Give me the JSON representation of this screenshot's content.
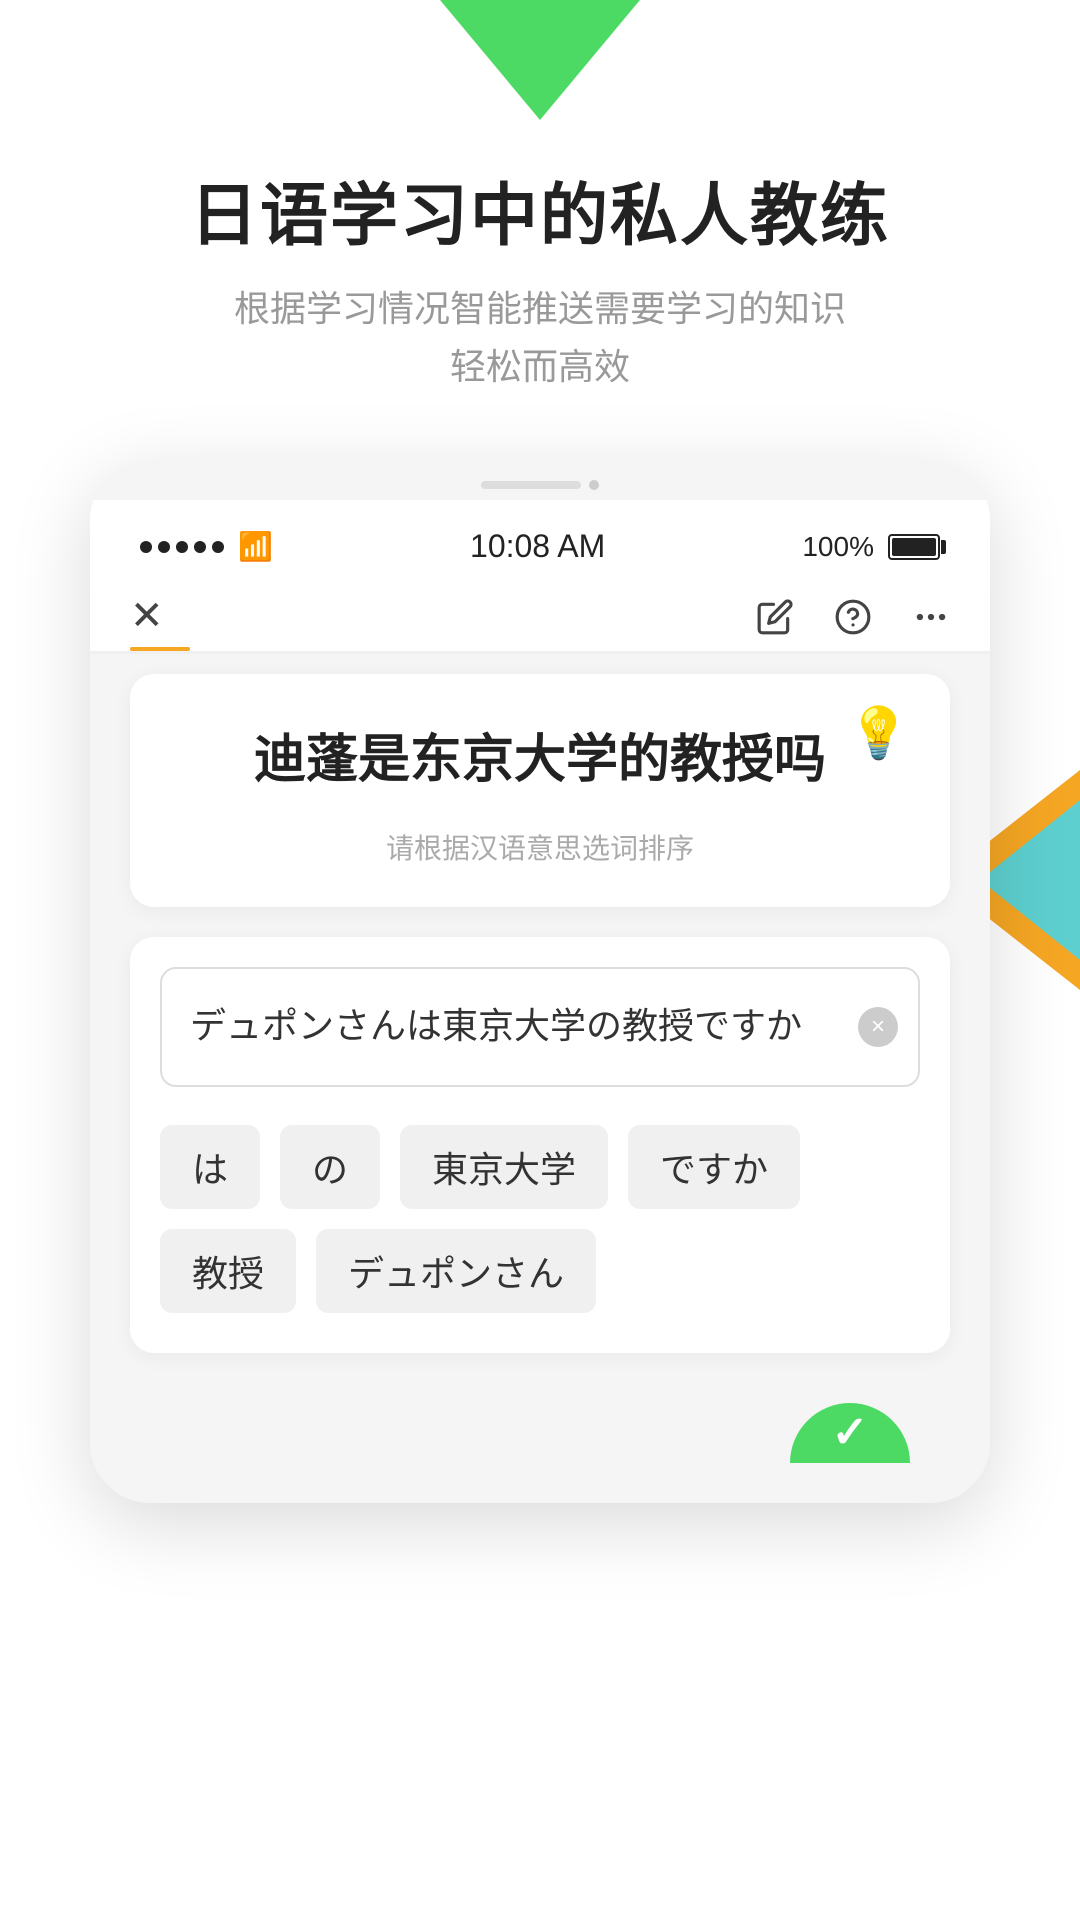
{
  "app": {
    "logo_triangle_color": "#4cd964"
  },
  "header": {
    "main_title": "日语学习中的私人教练",
    "subtitle_line1": "根据学习情况智能推送需要学习的知识",
    "subtitle_line2": "轻松而高效"
  },
  "phone": {
    "status_bar": {
      "time": "10:08 AM",
      "battery": "100%"
    },
    "nav": {
      "close_label": "✕",
      "edit_icon": "📝",
      "help_icon": "?",
      "more_icon": "..."
    },
    "question_card": {
      "main_text": "迪蓬是东京大学的教授吗",
      "hint_text": "请根据汉语意思选词排序",
      "lightbulb": "💡"
    },
    "answer_card": {
      "input_text": "デュポンさんは東京大学の教授ですか",
      "clear_btn": "×",
      "words": [
        "は",
        "の",
        "東京大学",
        "ですか",
        "教授",
        "デュポンさん"
      ]
    },
    "bottom_check": "✓"
  },
  "decorations": {
    "teal_color": "#5ecfcf",
    "orange_color": "#f5a623",
    "green_color": "#4cd964"
  }
}
